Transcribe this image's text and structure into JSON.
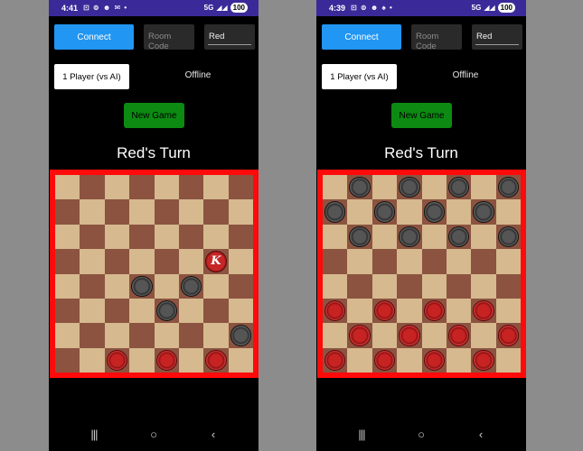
{
  "colors": {
    "connect_button": "#2196f3",
    "new_game_button": "#0c8a12",
    "board_frame": "#ff0a0a",
    "light_square": "#d6b98e",
    "dark_square": "#8b5340",
    "status_bar": "#3a2a99"
  },
  "screens": [
    {
      "status": {
        "time": "4:41",
        "icons": "⊡ ⊚ ☻ ✉ •",
        "network": "5G",
        "battery": "100"
      },
      "connect_label": "Connect",
      "room_code_placeholder": "Room Code",
      "player_name": "Red",
      "mode": "1 Player (vs AI)",
      "connection_status": "Offline",
      "new_game_label": "New Game",
      "turn_text": "Red's Turn",
      "board": [
        "........",
        "........",
        "........",
        "......K.",
        "...b.b..",
        "....b...",
        ".......b",
        "..r.r.r."
      ],
      "king_symbol": "K",
      "nav": {
        "recents_icon": "recents-icon",
        "home_icon": "home-icon",
        "back_icon": "back-icon"
      }
    },
    {
      "status": {
        "time": "4:39",
        "icons": "⊡ ⊚ ☻ ♠ •",
        "network": "5G",
        "battery": "100"
      },
      "connect_label": "Connect",
      "room_code_placeholder": "Room Code",
      "player_name": "Red",
      "mode": "1 Player (vs AI)",
      "connection_status": "Offline",
      "new_game_label": "New Game",
      "turn_text": "Red's Turn",
      "board": [
        ".b.b.b.b",
        "b.b.b.b.",
        ".b.b.b.b",
        "........",
        "........",
        "r.r.r.r.",
        ".r.r.r.r",
        "r.r.r.r."
      ],
      "king_symbol": "K",
      "nav": {
        "recents_icon": "recents-icon",
        "home_icon": "home-icon",
        "back_icon": "back-icon"
      }
    }
  ]
}
